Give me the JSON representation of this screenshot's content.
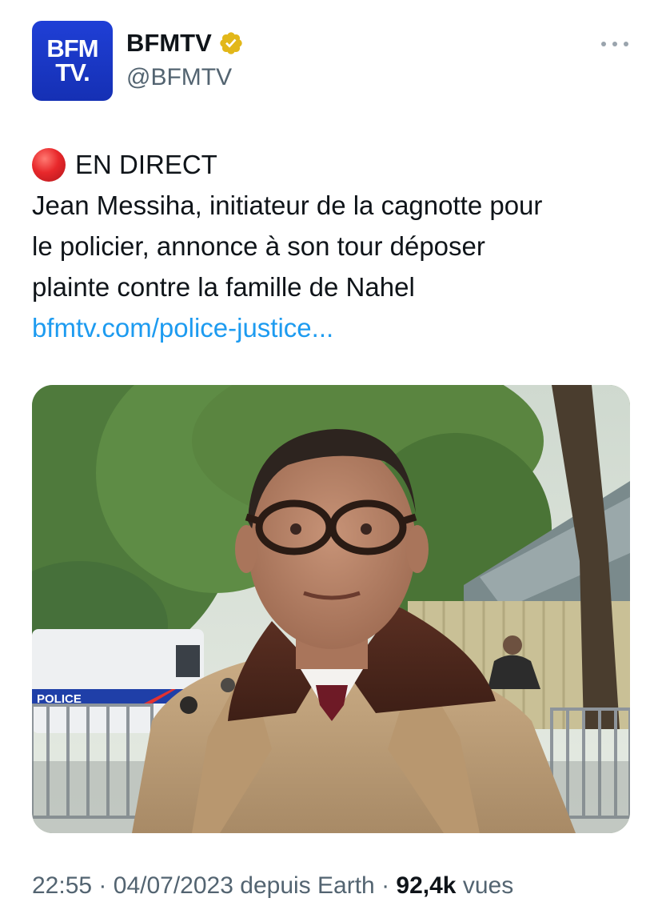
{
  "account": {
    "avatar_text_line1": "BFM",
    "avatar_text_line2": "TV.",
    "display_name": "BFMTV",
    "handle": "@BFMTV",
    "verified_icon": "gold-verified-badge-icon",
    "brand_color": "#1f3fd6",
    "badge_color": "#e2b719"
  },
  "tweet": {
    "live_label": "EN DIRECT",
    "live_icon": "red-circle-icon",
    "lines": [
      "Jean Messiha, initiateur de la cagnotte pour",
      "le policier, annonce à son tour déposer",
      "plainte contre la famille de Nahel"
    ],
    "link_text": "bfmtv.com/police-justice...",
    "link_color": "#1d9bf0"
  },
  "media": {
    "van_text": "POLICE"
  },
  "meta": {
    "time": "22:55",
    "separator": "·",
    "date": "04/07/2023",
    "source": "depuis Earth",
    "views_count": "92,4k",
    "views_label": "vues"
  }
}
